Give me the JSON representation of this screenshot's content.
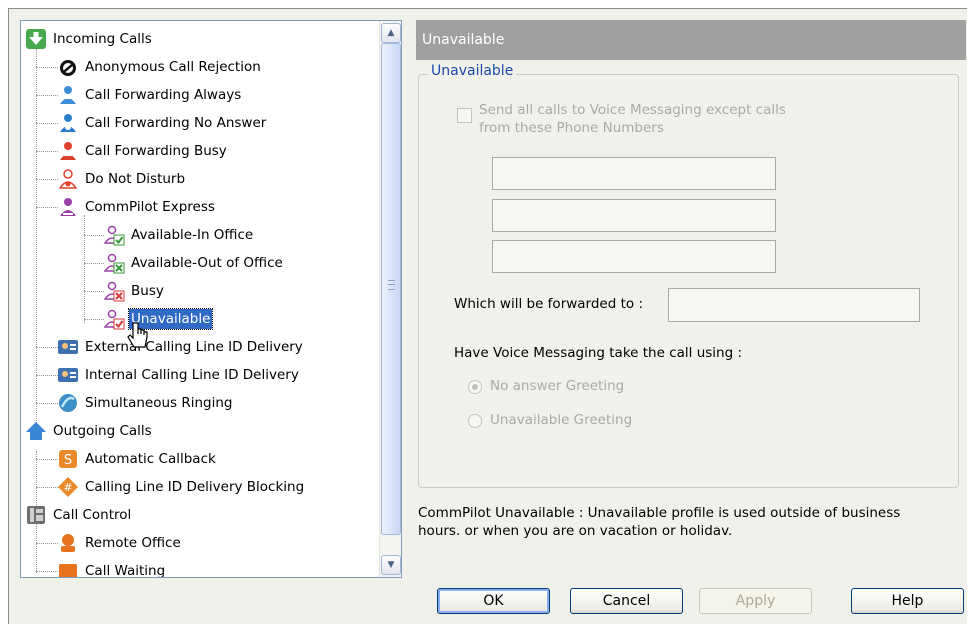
{
  "tree": {
    "items": [
      {
        "label": "Incoming Calls",
        "icon": "incoming-calls-icon"
      },
      {
        "label": "Anonymous Call Rejection",
        "icon": "anonymous-rejection-icon"
      },
      {
        "label": "Call Forwarding Always",
        "icon": "forwarding-always-icon"
      },
      {
        "label": "Call Forwarding No Answer",
        "icon": "forwarding-no-answer-icon"
      },
      {
        "label": "Call Forwarding Busy",
        "icon": "forwarding-busy-icon"
      },
      {
        "label": "Do Not Disturb",
        "icon": "do-not-disturb-icon"
      },
      {
        "label": "CommPilot Express",
        "icon": "commpilot-express-icon"
      },
      {
        "label": "Available-In Office",
        "icon": "available-in-office-icon"
      },
      {
        "label": "Available-Out of Office",
        "icon": "available-out-of-office-icon"
      },
      {
        "label": "Busy",
        "icon": "busy-icon"
      },
      {
        "label": "Unavailable",
        "icon": "unavailable-icon"
      },
      {
        "label": "External Calling Line ID Delivery",
        "icon": "external-clid-icon"
      },
      {
        "label": "Internal Calling Line ID Delivery",
        "icon": "internal-clid-icon"
      },
      {
        "label": "Simultaneous Ringing",
        "icon": "simultaneous-ringing-icon"
      },
      {
        "label": "Outgoing Calls",
        "icon": "outgoing-calls-icon"
      },
      {
        "label": "Automatic Callback",
        "icon": "automatic-callback-icon"
      },
      {
        "label": "Calling Line ID Delivery Blocking",
        "icon": "clid-blocking-icon"
      },
      {
        "label": "Call Control",
        "icon": "call-control-icon"
      },
      {
        "label": "Remote Office",
        "icon": "remote-office-icon"
      },
      {
        "label": "Call Waiting",
        "icon": "call-waiting-icon"
      }
    ],
    "selected": "Unavailable"
  },
  "panel": {
    "header": "Unavailable",
    "group_title": "Unavailable",
    "checkbox_label_line1": "Send all calls to Voice Messaging except calls",
    "checkbox_label_line2": "from these Phone Numbers",
    "checkbox_checked": false,
    "phone_numbers": [
      "",
      "",
      ""
    ],
    "forward_label": "Which will be forwarded to :",
    "forward_value": "",
    "vm_label": "Have Voice Messaging take the call using :",
    "radio_no_answer": "No answer Greeting",
    "radio_unavailable": "Unavailable Greeting",
    "selected_greeting": "No answer Greeting",
    "description_line1": "CommPilot Unavailable : Unavailable profile is used outside of business",
    "description_line2": "hours. or when you are on vacation or holidav."
  },
  "buttons": {
    "ok": "OK",
    "cancel": "Cancel",
    "apply": "Apply",
    "help": "Help"
  },
  "colors": {
    "selection": "#316ac5",
    "header_bg": "#a0a0a0",
    "group_title": "#1b49a8"
  }
}
